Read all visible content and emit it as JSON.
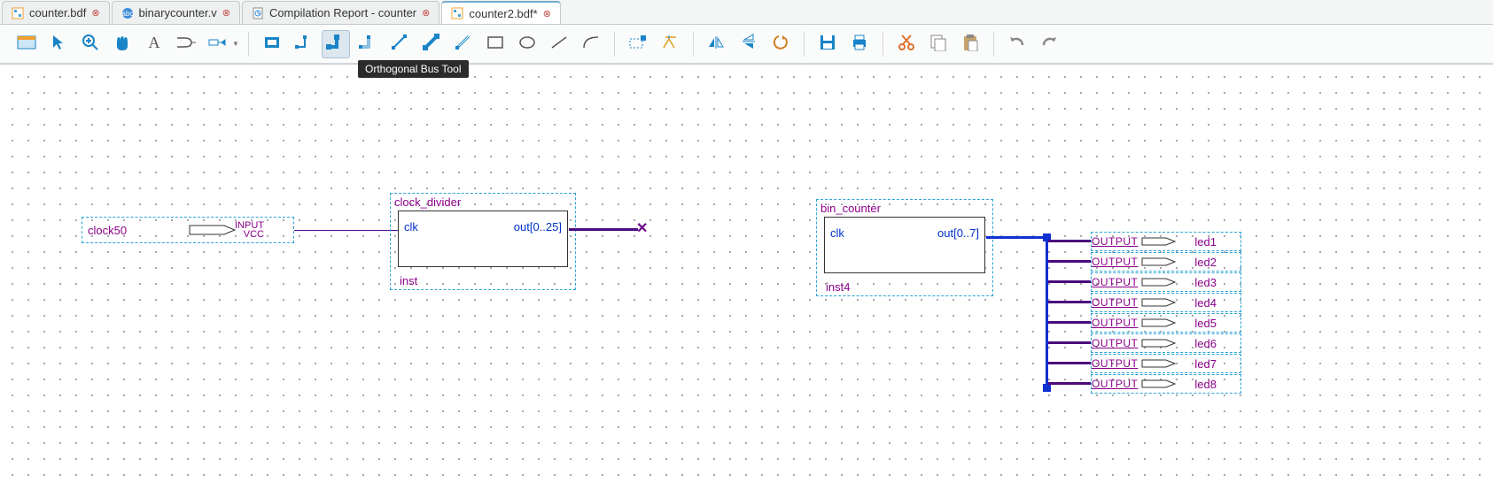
{
  "tabs": [
    {
      "label": "counter.bdf",
      "icon": "bdf"
    },
    {
      "label": "binarycounter.v",
      "icon": "verilog"
    },
    {
      "label": "Compilation Report - counter",
      "icon": "report"
    },
    {
      "label": "counter2.bdf*",
      "icon": "bdf",
      "active": true
    }
  ],
  "toolbar": {
    "tooltip": "Orthogonal Bus Tool",
    "items": [
      {
        "name": "editor-view-icon",
        "title": "View"
      },
      {
        "name": "pointer-icon",
        "title": "Selection Tool"
      },
      {
        "name": "zoom-in-icon",
        "title": "Zoom"
      },
      {
        "name": "pan-hand-icon",
        "title": "Pan"
      },
      {
        "name": "text-tool-icon",
        "title": "Text"
      },
      {
        "name": "symbol-tool-icon",
        "title": "Symbol Tool"
      },
      {
        "name": "pin-tool-icon",
        "title": "Pin Tool",
        "dropdown": true
      },
      {
        "sep": true
      },
      {
        "name": "rectangle-icon",
        "title": "Rectangle"
      },
      {
        "name": "node-wire-icon",
        "title": "Orthogonal Node Tool"
      },
      {
        "name": "orth-bus-icon",
        "title": "Orthogonal Bus Tool",
        "active": true
      },
      {
        "name": "conduit-icon",
        "title": "Orthogonal Conduit Tool"
      },
      {
        "name": "diag-node-icon",
        "title": "Diagonal Node Tool"
      },
      {
        "name": "diag-bus-icon",
        "title": "Diagonal Bus Tool"
      },
      {
        "name": "diag-conduit-icon",
        "title": "Diagonal Conduit Tool"
      },
      {
        "name": "outline-rect-icon",
        "title": "Rectangle Outline"
      },
      {
        "name": "oval-icon",
        "title": "Oval"
      },
      {
        "name": "line-icon",
        "title": "Line"
      },
      {
        "name": "arc-icon",
        "title": "Arc"
      },
      {
        "sep": true
      },
      {
        "name": "partial-line-icon",
        "title": "Partial line selection"
      },
      {
        "name": "rubber-band-icon",
        "title": "Rubberbanding"
      },
      {
        "sep": true
      },
      {
        "name": "flip-h-icon",
        "title": "Flip Horizontal"
      },
      {
        "name": "flip-v-icon",
        "title": "Flip Vertical"
      },
      {
        "name": "rotate-icon",
        "title": "Rotate"
      },
      {
        "sep": true
      },
      {
        "name": "save-icon",
        "title": "Save"
      },
      {
        "name": "print-icon",
        "title": "Print"
      },
      {
        "sep": true
      },
      {
        "name": "cut-icon",
        "title": "Cut"
      },
      {
        "name": "copy-icon",
        "title": "Copy"
      },
      {
        "name": "paste-icon",
        "title": "Paste"
      },
      {
        "sep": true
      },
      {
        "name": "undo-icon",
        "title": "Undo"
      },
      {
        "name": "redo-icon",
        "title": "Redo"
      }
    ]
  },
  "diagram": {
    "input_pin": {
      "label": "clock50",
      "type1": "INPUT",
      "type2": "VCC"
    },
    "block1": {
      "title": "clock_divider",
      "in": "clk",
      "out": "out[0..25]",
      "inst": "inst"
    },
    "block2": {
      "title": "bin_counter",
      "in": "clk",
      "out": "out[0..7]",
      "inst": "inst4"
    },
    "outputs": [
      {
        "txt": "OUTPUT",
        "name": "led1"
      },
      {
        "txt": "OUTPUT",
        "name": "led2"
      },
      {
        "txt": "OUTPUT",
        "name": "led3"
      },
      {
        "txt": "OUTPUT",
        "name": "led4"
      },
      {
        "txt": "OUTPUT",
        "name": "led5"
      },
      {
        "txt": "OUTPUT",
        "name": "led6"
      },
      {
        "txt": "OUTPUT",
        "name": "led7"
      },
      {
        "txt": "OUTPUT",
        "name": "led8"
      }
    ]
  }
}
